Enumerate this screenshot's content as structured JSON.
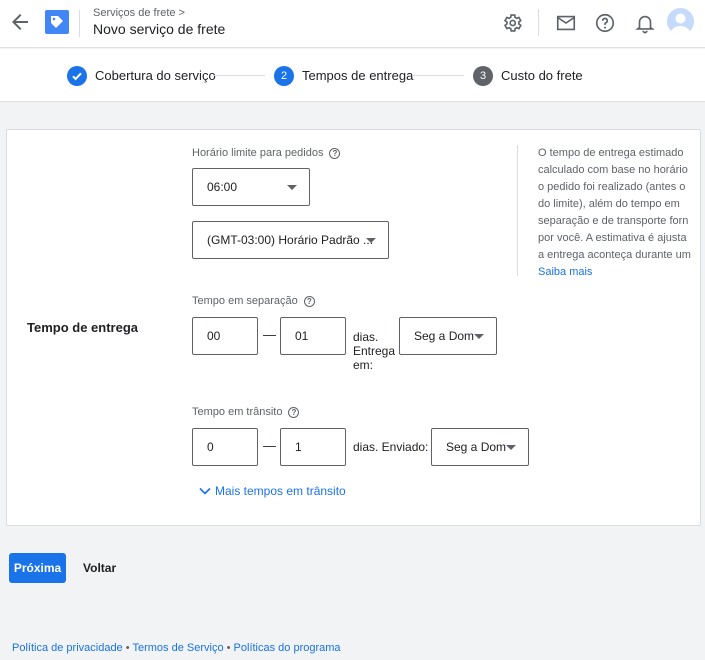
{
  "header": {
    "breadcrumb": "Serviços de frete",
    "breadcrumb_chevron": ">",
    "title": "Novo serviço de frete",
    "icons": [
      "back-arrow-icon",
      "shipping-tag-icon",
      "gear-icon",
      "mail-icon",
      "help-icon",
      "bell-icon",
      "avatar-icon"
    ]
  },
  "stepper": {
    "steps": [
      {
        "label": "Cobertura do serviço",
        "state": "done"
      },
      {
        "number": "2",
        "label": "Tempos de entrega",
        "state": "active"
      },
      {
        "number": "3",
        "label": "Custo do frete",
        "state": "pending"
      }
    ]
  },
  "form": {
    "section_label": "Tempo de entrega",
    "cutoff": {
      "label": "Horário limite para pedidos",
      "time_value": "06:00",
      "timezone_value": "(GMT-03:00) Horário Padrão ..."
    },
    "handling": {
      "label": "Tempo em separação",
      "min": "00",
      "dash": "—",
      "max": "01",
      "suffix_lines": [
        "dias.",
        "Entrega",
        "em:"
      ],
      "days_value": "Seg a Dom"
    },
    "transit": {
      "label": "Tempo em trânsito",
      "min": "0",
      "dash": "—",
      "max": "1",
      "suffix": "dias. Enviado:",
      "days_value": "Seg a Dom"
    },
    "more_link": "Mais tempos em trânsito"
  },
  "help": {
    "lines": [
      "O tempo de entrega estimado",
      "calculado com base no horário",
      "o pedido foi realizado (antes o",
      "do limite), além do tempo em",
      "separação e de transporte forn",
      "por você. A estimativa é ajusta",
      "a entrega aconteça durante um"
    ],
    "link": "Saiba mais"
  },
  "actions": {
    "next": "Próxima",
    "back": "Voltar"
  },
  "footer": {
    "privacy": "Política de privacidade",
    "sep": "•",
    "terms": "Termos de Serviço",
    "policies": "Políticas do programa"
  },
  "colors": {
    "accent": "#1a73e8",
    "step_done": "#1a73e8",
    "step_pending": "#5f6368"
  }
}
